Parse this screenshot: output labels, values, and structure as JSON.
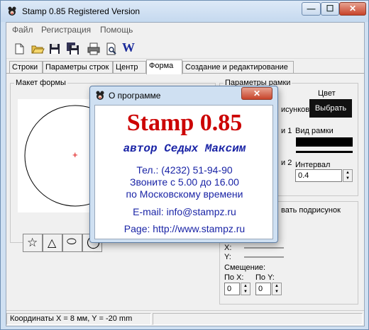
{
  "window": {
    "title": "Stamp 0.85 Registered Version",
    "min_glyph": "—",
    "max_glyph": "☐",
    "close_glyph": "✕"
  },
  "menu": [
    "Файл",
    "Регистрация",
    "Помощь"
  ],
  "toolbar": {
    "icons": [
      "new-icon",
      "open-icon",
      "save-icon",
      "save-all-icon",
      "print-icon",
      "print-preview-icon",
      "word-export-icon"
    ],
    "word_label": "W"
  },
  "tabs": [
    "Строки",
    "Параметры строк",
    "Центр",
    "Форма",
    "Создание и редактирование"
  ],
  "active_tab": "Форма",
  "maket": {
    "label": "Макет формы",
    "center_marker": "+"
  },
  "shapes": [
    "☆",
    "△",
    "⬭",
    "◯"
  ],
  "frame": {
    "label": "Параметры рамки",
    "color_label": "Цвет",
    "choose_button": "Выбрать",
    "partial_contour": "исунков",
    "partial_1": "и 1",
    "partial_2": "и 2",
    "frame_type_label": "Вид рамки",
    "interval_label": "Интервал",
    "interval_value": "0.4"
  },
  "picture": {
    "partial_label": "вать подрисунок",
    "x_label": "X:",
    "y_label": "Y:",
    "offset_label": "Смещение:",
    "po_x_label": "По X:",
    "po_y_label": "По Y:",
    "po_x_value": "0",
    "po_y_value": "0"
  },
  "status": {
    "text": "Координаты  X = 8 мм,     Y = -20 mm"
  },
  "dialog": {
    "title": "О программе",
    "app_name": "Stamp 0.85",
    "author": "автор Седых Максим",
    "phone": "Тел.: (4232) 51-94-90",
    "hours": "Звоните с 5.00 до 16.00",
    "timezone": "по Московскому времени",
    "email": "E-mail: info@stampz.ru",
    "page": "Page: http://www.stampz.ru",
    "close_glyph": "✕"
  },
  "colors": {
    "app_name": "#cc0000",
    "author": "#1a24a6",
    "link": "#1a24a6",
    "frame_color_swatch": "#000000"
  }
}
